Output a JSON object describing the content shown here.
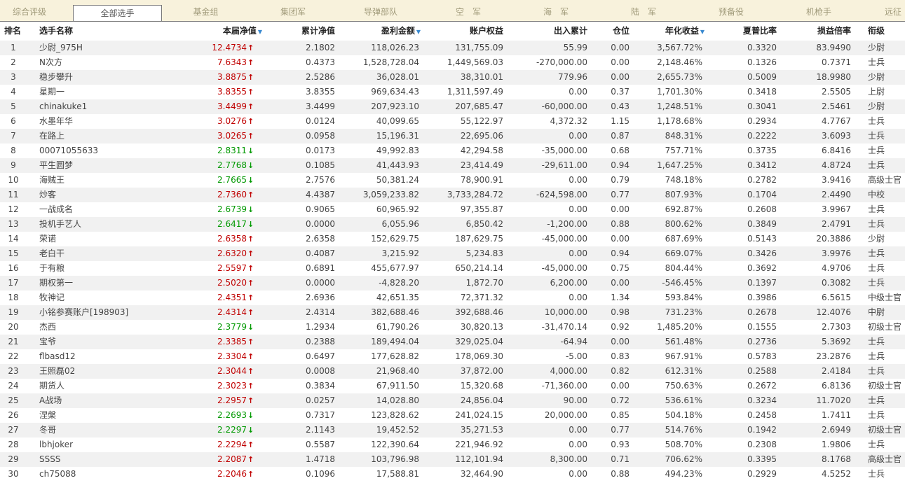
{
  "tabs": [
    {
      "label": "综合评级",
      "active": false
    },
    {
      "label": "全部选手",
      "active": true
    },
    {
      "label": "基金组",
      "active": false
    },
    {
      "label": "集团军",
      "active": false
    },
    {
      "label": "导弹部队",
      "active": false
    },
    {
      "label": "空　军",
      "active": false
    },
    {
      "label": "海　军",
      "active": false
    },
    {
      "label": "陆　军",
      "active": false
    },
    {
      "label": "预备役",
      "active": false
    },
    {
      "label": "机枪手",
      "active": false
    },
    {
      "label": "远征",
      "active": false
    }
  ],
  "headers": {
    "rank": "排名",
    "name": "选手名称",
    "nav": "本届净值",
    "cum_nav": "累计净值",
    "profit": "盈利金额",
    "equity": "账户权益",
    "flow": "出入累计",
    "position": "仓位",
    "annual": "年化收益",
    "sharpe": "夏普比率",
    "pl_ratio": "损益倍率",
    "title": "衔级"
  },
  "sort_icon": "sort-down-triangle",
  "colors": {
    "up": "#c00000",
    "down": "#009900",
    "sort": "#3a8ad0"
  },
  "rows": [
    {
      "rank": "1",
      "name": "少尉_975H",
      "nav": "12.4734",
      "dir": "up",
      "cum_nav": "2.1802",
      "profit": "118,026.23",
      "equity": "131,755.09",
      "flow": "55.99",
      "position": "0.00",
      "annual": "3,567.72%",
      "sharpe": "0.3320",
      "pl_ratio": "83.9490",
      "title": "少尉"
    },
    {
      "rank": "2",
      "name": "N次方",
      "nav": "7.6343",
      "dir": "up",
      "cum_nav": "0.4373",
      "profit": "1,528,728.04",
      "equity": "1,449,569.03",
      "flow": "-270,000.00",
      "position": "0.00",
      "annual": "2,148.46%",
      "sharpe": "0.1326",
      "pl_ratio": "0.7371",
      "title": "士兵"
    },
    {
      "rank": "3",
      "name": "稳步攀升",
      "nav": "3.8875",
      "dir": "up",
      "cum_nav": "2.5286",
      "profit": "36,028.01",
      "equity": "38,310.01",
      "flow": "779.96",
      "position": "0.00",
      "annual": "2,655.73%",
      "sharpe": "0.5009",
      "pl_ratio": "18.9980",
      "title": "少尉"
    },
    {
      "rank": "4",
      "name": "星期一",
      "nav": "3.8355",
      "dir": "up",
      "cum_nav": "3.8355",
      "profit": "969,634.43",
      "equity": "1,311,597.49",
      "flow": "0.00",
      "position": "0.37",
      "annual": "1,701.30%",
      "sharpe": "0.3418",
      "pl_ratio": "2.5505",
      "title": "上尉"
    },
    {
      "rank": "5",
      "name": "chinakuke1",
      "nav": "3.4499",
      "dir": "up",
      "cum_nav": "3.4499",
      "profit": "207,923.10",
      "equity": "207,685.47",
      "flow": "-60,000.00",
      "position": "0.43",
      "annual": "1,248.51%",
      "sharpe": "0.3041",
      "pl_ratio": "2.5461",
      "title": "少尉"
    },
    {
      "rank": "6",
      "name": "水墨年华",
      "nav": "3.0276",
      "dir": "up",
      "cum_nav": "0.0124",
      "profit": "40,099.65",
      "equity": "55,122.97",
      "flow": "4,372.32",
      "position": "1.15",
      "annual": "1,178.68%",
      "sharpe": "0.2934",
      "pl_ratio": "4.7767",
      "title": "士兵"
    },
    {
      "rank": "7",
      "name": "在路上",
      "nav": "3.0265",
      "dir": "up",
      "cum_nav": "0.0958",
      "profit": "15,196.31",
      "equity": "22,695.06",
      "flow": "0.00",
      "position": "0.87",
      "annual": "848.31%",
      "sharpe": "0.2222",
      "pl_ratio": "3.6093",
      "title": "士兵"
    },
    {
      "rank": "8",
      "name": "00071055633",
      "nav": "2.8311",
      "dir": "down",
      "cum_nav": "0.0173",
      "profit": "49,992.83",
      "equity": "42,294.58",
      "flow": "-35,000.00",
      "position": "0.68",
      "annual": "757.71%",
      "sharpe": "0.3735",
      "pl_ratio": "6.8416",
      "title": "士兵"
    },
    {
      "rank": "9",
      "name": "平生圆梦",
      "nav": "2.7768",
      "dir": "down",
      "cum_nav": "0.1085",
      "profit": "41,443.93",
      "equity": "23,414.49",
      "flow": "-29,611.00",
      "position": "0.94",
      "annual": "1,647.25%",
      "sharpe": "0.3412",
      "pl_ratio": "4.8724",
      "title": "士兵"
    },
    {
      "rank": "10",
      "name": "海贼王",
      "nav": "2.7665",
      "dir": "down",
      "cum_nav": "2.7576",
      "profit": "50,381.24",
      "equity": "78,900.91",
      "flow": "0.00",
      "position": "0.79",
      "annual": "748.18%",
      "sharpe": "0.2782",
      "pl_ratio": "3.9416",
      "title": "高级士官"
    },
    {
      "rank": "11",
      "name": "炒客",
      "nav": "2.7360",
      "dir": "up",
      "cum_nav": "4.4387",
      "profit": "3,059,233.82",
      "equity": "3,733,284.72",
      "flow": "-624,598.00",
      "position": "0.77",
      "annual": "807.93%",
      "sharpe": "0.1704",
      "pl_ratio": "2.4490",
      "title": "中校"
    },
    {
      "rank": "12",
      "name": "一战成名",
      "nav": "2.6739",
      "dir": "down",
      "cum_nav": "0.9065",
      "profit": "60,965.92",
      "equity": "97,355.87",
      "flow": "0.00",
      "position": "0.00",
      "annual": "692.87%",
      "sharpe": "0.2608",
      "pl_ratio": "3.9967",
      "title": "士兵"
    },
    {
      "rank": "13",
      "name": "投机手艺人",
      "nav": "2.6417",
      "dir": "down",
      "cum_nav": "0.0000",
      "profit": "6,055.96",
      "equity": "6,850.42",
      "flow": "-1,200.00",
      "position": "0.88",
      "annual": "800.62%",
      "sharpe": "0.3849",
      "pl_ratio": "2.4791",
      "title": "士兵"
    },
    {
      "rank": "14",
      "name": "荣诺",
      "nav": "2.6358",
      "dir": "up",
      "cum_nav": "2.6358",
      "profit": "152,629.75",
      "equity": "187,629.75",
      "flow": "-45,000.00",
      "position": "0.00",
      "annual": "687.69%",
      "sharpe": "0.5143",
      "pl_ratio": "20.3886",
      "title": "少尉"
    },
    {
      "rank": "15",
      "name": "老白干",
      "nav": "2.6320",
      "dir": "up",
      "cum_nav": "0.4087",
      "profit": "3,215.92",
      "equity": "5,234.83",
      "flow": "0.00",
      "position": "0.94",
      "annual": "669.07%",
      "sharpe": "0.3426",
      "pl_ratio": "3.9976",
      "title": "士兵"
    },
    {
      "rank": "16",
      "name": "于有粮",
      "nav": "2.5597",
      "dir": "up",
      "cum_nav": "0.6891",
      "profit": "455,677.97",
      "equity": "650,214.14",
      "flow": "-45,000.00",
      "position": "0.75",
      "annual": "804.44%",
      "sharpe": "0.3692",
      "pl_ratio": "4.9706",
      "title": "士兵"
    },
    {
      "rank": "17",
      "name": "期权第一",
      "nav": "2.5020",
      "dir": "up",
      "cum_nav": "0.0000",
      "profit": "-4,828.20",
      "equity": "1,872.70",
      "flow": "6,200.00",
      "position": "0.00",
      "annual": "-546.45%",
      "sharpe": "0.1397",
      "pl_ratio": "0.3082",
      "title": "士兵"
    },
    {
      "rank": "18",
      "name": "牧神记",
      "nav": "2.4351",
      "dir": "up",
      "cum_nav": "2.6936",
      "profit": "42,651.35",
      "equity": "72,371.32",
      "flow": "0.00",
      "position": "1.34",
      "annual": "593.84%",
      "sharpe": "0.3986",
      "pl_ratio": "6.5615",
      "title": "中级士官"
    },
    {
      "rank": "19",
      "name": "小铭参赛账户[198903]",
      "nav": "2.4314",
      "dir": "up",
      "cum_nav": "2.4314",
      "profit": "382,688.46",
      "equity": "392,688.46",
      "flow": "10,000.00",
      "position": "0.98",
      "annual": "731.23%",
      "sharpe": "0.2678",
      "pl_ratio": "12.4076",
      "title": "中尉"
    },
    {
      "rank": "20",
      "name": "杰西",
      "nav": "2.3779",
      "dir": "down",
      "cum_nav": "1.2934",
      "profit": "61,790.26",
      "equity": "30,820.13",
      "flow": "-31,470.14",
      "position": "0.92",
      "annual": "1,485.20%",
      "sharpe": "0.1555",
      "pl_ratio": "2.7303",
      "title": "初级士官"
    },
    {
      "rank": "21",
      "name": "宝爷",
      "nav": "2.3385",
      "dir": "up",
      "cum_nav": "0.2388",
      "profit": "189,494.04",
      "equity": "329,025.04",
      "flow": "-64.94",
      "position": "0.00",
      "annual": "561.48%",
      "sharpe": "0.2736",
      "pl_ratio": "5.3692",
      "title": "士兵"
    },
    {
      "rank": "22",
      "name": "flbasd12",
      "nav": "2.3304",
      "dir": "up",
      "cum_nav": "0.6497",
      "profit": "177,628.82",
      "equity": "178,069.30",
      "flow": "-5.00",
      "position": "0.83",
      "annual": "967.91%",
      "sharpe": "0.5783",
      "pl_ratio": "23.2876",
      "title": "士兵"
    },
    {
      "rank": "23",
      "name": "王照磊02",
      "nav": "2.3044",
      "dir": "up",
      "cum_nav": "0.0008",
      "profit": "21,968.40",
      "equity": "37,872.00",
      "flow": "4,000.00",
      "position": "0.82",
      "annual": "612.31%",
      "sharpe": "0.2588",
      "pl_ratio": "2.4184",
      "title": "士兵"
    },
    {
      "rank": "24",
      "name": "期货人",
      "nav": "2.3023",
      "dir": "up",
      "cum_nav": "0.3834",
      "profit": "67,911.50",
      "equity": "15,320.68",
      "flow": "-71,360.00",
      "position": "0.00",
      "annual": "750.63%",
      "sharpe": "0.2672",
      "pl_ratio": "6.8136",
      "title": "初级士官"
    },
    {
      "rank": "25",
      "name": "A战场",
      "nav": "2.2957",
      "dir": "up",
      "cum_nav": "0.0257",
      "profit": "14,028.80",
      "equity": "24,856.04",
      "flow": "90.00",
      "position": "0.72",
      "annual": "536.61%",
      "sharpe": "0.3234",
      "pl_ratio": "11.7020",
      "title": "士兵"
    },
    {
      "rank": "26",
      "name": "涅槃",
      "nav": "2.2693",
      "dir": "down",
      "cum_nav": "0.7317",
      "profit": "123,828.62",
      "equity": "241,024.15",
      "flow": "20,000.00",
      "position": "0.85",
      "annual": "504.18%",
      "sharpe": "0.2458",
      "pl_ratio": "1.7411",
      "title": "士兵"
    },
    {
      "rank": "27",
      "name": "冬哥",
      "nav": "2.2297",
      "dir": "down",
      "cum_nav": "2.1143",
      "profit": "19,452.52",
      "equity": "35,271.53",
      "flow": "0.00",
      "position": "0.77",
      "annual": "514.76%",
      "sharpe": "0.1942",
      "pl_ratio": "2.6949",
      "title": "初级士官"
    },
    {
      "rank": "28",
      "name": "lbhjoker",
      "nav": "2.2294",
      "dir": "up",
      "cum_nav": "0.5587",
      "profit": "122,390.64",
      "equity": "221,946.92",
      "flow": "0.00",
      "position": "0.93",
      "annual": "508.70%",
      "sharpe": "0.2308",
      "pl_ratio": "1.9806",
      "title": "士兵"
    },
    {
      "rank": "29",
      "name": "SSSS",
      "nav": "2.2087",
      "dir": "up",
      "cum_nav": "1.4718",
      "profit": "103,796.98",
      "equity": "112,101.94",
      "flow": "8,300.00",
      "position": "0.71",
      "annual": "706.62%",
      "sharpe": "0.3395",
      "pl_ratio": "8.1768",
      "title": "高级士官"
    },
    {
      "rank": "30",
      "name": "ch75088",
      "nav": "2.2046",
      "dir": "up",
      "cum_nav": "0.1096",
      "profit": "17,588.81",
      "equity": "32,464.90",
      "flow": "0.00",
      "position": "0.88",
      "annual": "494.23%",
      "sharpe": "0.2929",
      "pl_ratio": "4.5252",
      "title": "士兵"
    }
  ]
}
